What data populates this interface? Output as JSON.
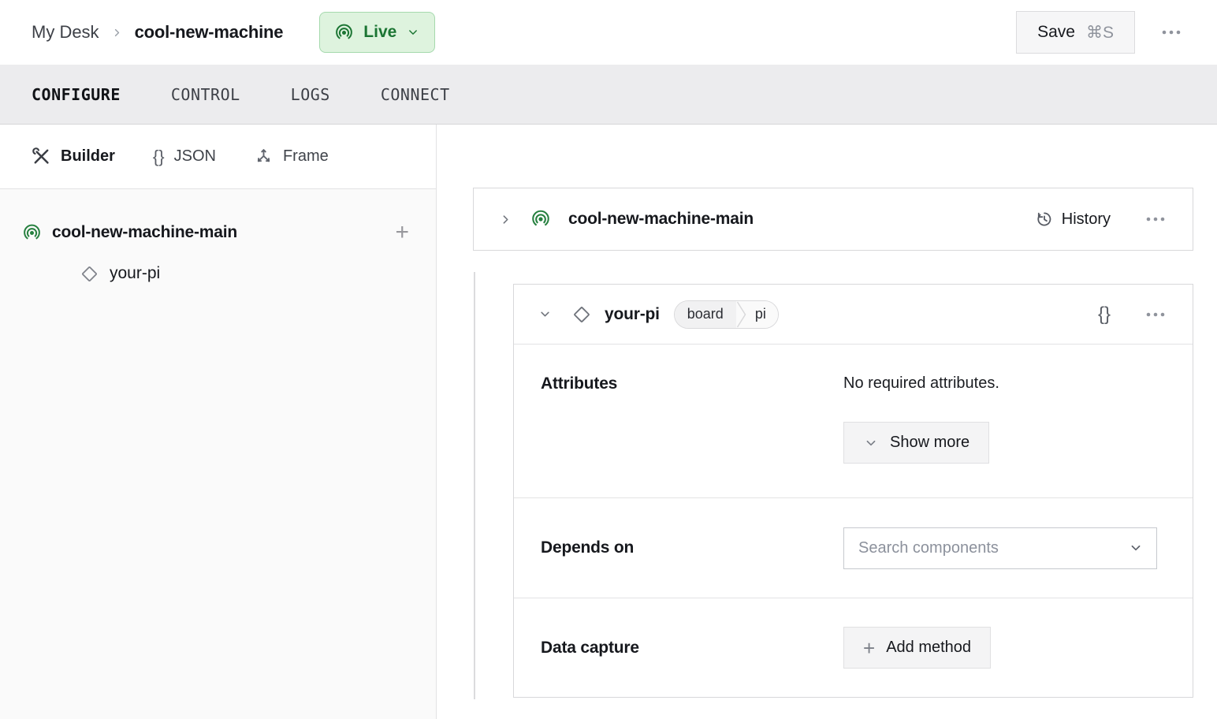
{
  "topbar": {
    "breadcrumb": {
      "parent": "My Desk",
      "current": "cool-new-machine"
    },
    "live_badge": {
      "label": "Live"
    },
    "save_button": {
      "label": "Save",
      "shortcut": "⌘S"
    }
  },
  "nav_tabs": {
    "configure": "CONFIGURE",
    "control": "CONTROL",
    "logs": "LOGS",
    "connect": "CONNECT"
  },
  "sidebar": {
    "views": {
      "builder": "Builder",
      "json": "JSON",
      "frame": "Frame"
    },
    "tree": {
      "machine": {
        "label": "cool-new-machine-main"
      },
      "component": {
        "label": "your-pi"
      }
    }
  },
  "main": {
    "machine_card": {
      "title": "cool-new-machine-main",
      "history": "History"
    },
    "component_card": {
      "title": "your-pi",
      "badge": {
        "type": "board",
        "model": "pi"
      },
      "attributes": {
        "label": "Attributes",
        "empty_text": "No required attributes.",
        "show_more": "Show more"
      },
      "depends_on": {
        "label": "Depends on",
        "placeholder": "Search components"
      },
      "data_capture": {
        "label": "Data capture",
        "add_method": "Add method"
      }
    }
  },
  "glyphs": {
    "json_braces": "{}",
    "plus": "+"
  },
  "colors": {
    "live_text": "#1b7533",
    "live_bg": "#def3de",
    "live_border": "#a5d9ad",
    "icon_green": "#26803f",
    "tabbar_bg": "#ececee",
    "card_border": "#d8d8da"
  }
}
